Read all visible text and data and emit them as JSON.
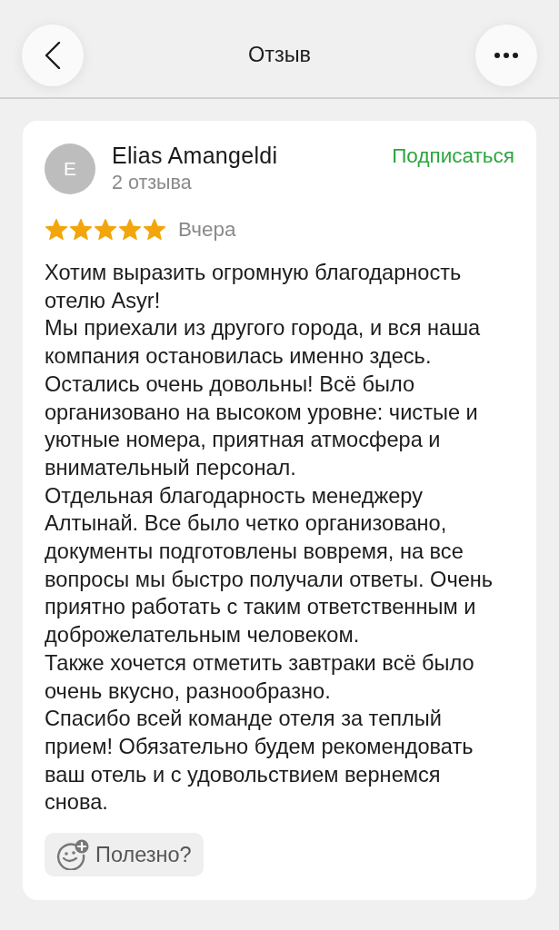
{
  "header": {
    "title": "Отзыв"
  },
  "review": {
    "author": {
      "initial": "E",
      "name": "Elias Amangeldi",
      "reviews_count": "2 отзыва"
    },
    "subscribe": "Подписаться",
    "stars": 5,
    "date": "Вчера",
    "paragraphs": [
      "Хотим выразить огромную благодарность отелю Asyr!",
      "Мы приехали из другого города, и вся наша компания остановилась именно здесь. Остались очень довольны! Всё было организовано на высоком уровне: чистые и уютные номера, приятная атмосфера и внимательный персонал.",
      "Отдельная благодарность менеджеру Алтынай. Все было четко организовано, документы подготовлены вовремя, на все вопросы мы быстро получали ответы. Очень приятно работать с таким ответственным и доброжелательным человеком.",
      "Также хочется отметить завтраки всё было очень вкусно, разнообразно.",
      "Спасибо всей команде отеля за теплый прием! Обязательно будем рекомендовать ваш отель и с удовольствием вернемся снова."
    ]
  },
  "helpful_button": {
    "label": "Полезно?"
  }
}
